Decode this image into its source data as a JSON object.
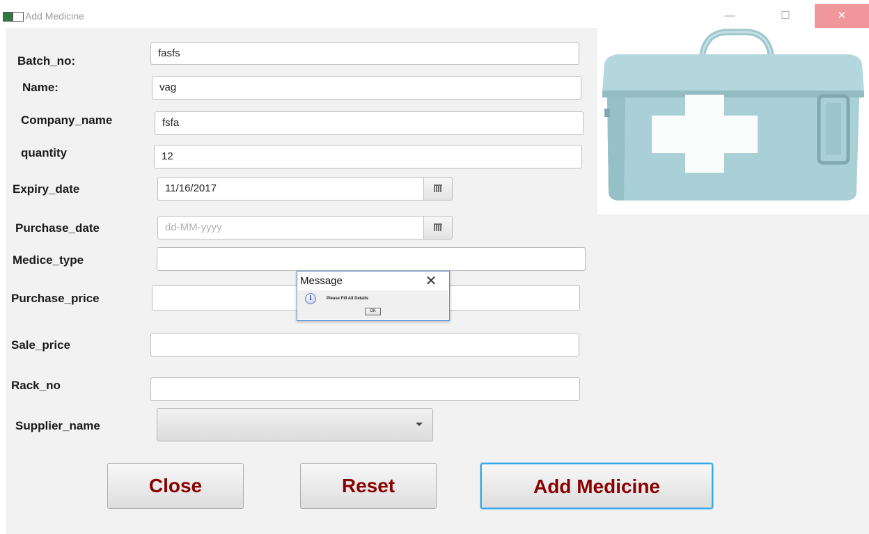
{
  "window": {
    "title": "Add Medicine",
    "minimize_glyph": "—",
    "maximize_glyph": "☐",
    "close_glyph": "✕"
  },
  "form": {
    "batch_no": {
      "label": "Batch_no:",
      "value": "fasfs"
    },
    "name": {
      "label": "Name:",
      "value": "vag"
    },
    "company_name": {
      "label": "Company_name",
      "value": "fsfa"
    },
    "quantity": {
      "label": "quantity",
      "value": "12"
    },
    "expiry_date": {
      "label": "Expiry_date",
      "value": "11/16/2017"
    },
    "purchase_date": {
      "label": "Purchase_date",
      "value": "",
      "placeholder": "dd-MM-yyyy"
    },
    "medicine_type": {
      "label": "Medice_type",
      "value": ""
    },
    "purchase_price": {
      "label": "Purchase_price",
      "value": ""
    },
    "sale_price": {
      "label": "Sale_price",
      "value": ""
    },
    "rack_no": {
      "label": "Rack_no",
      "value": ""
    },
    "supplier_name": {
      "label": "Supplier_name",
      "value": ""
    }
  },
  "buttons": {
    "close": "Close",
    "reset": "Reset",
    "add": "Add Medicine"
  },
  "dialog": {
    "title": "Message",
    "close_glyph": "✕",
    "icon_glyph": "i",
    "message": "Please Fill All Details",
    "ok": "OK"
  },
  "colors": {
    "button_text": "#8b0000",
    "close_button_bg": "#f1979c",
    "focus_border": "#39a7e8",
    "box_color": "#a8d0d6"
  }
}
